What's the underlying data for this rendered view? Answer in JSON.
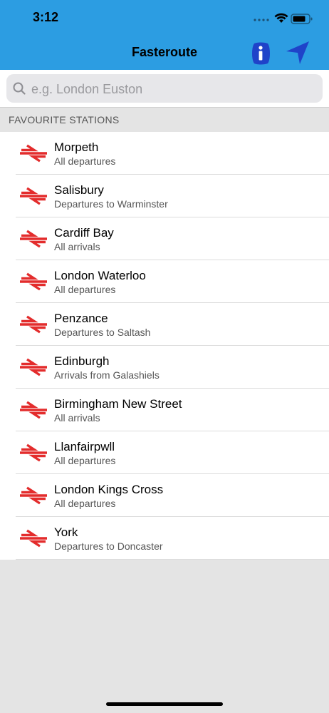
{
  "status_bar": {
    "time": "3:12"
  },
  "nav": {
    "title": "Fasteroute"
  },
  "search": {
    "placeholder": "e.g. London Euston",
    "value": ""
  },
  "section": {
    "title": "FAVOURITE STATIONS"
  },
  "colors": {
    "header": "#2c9de2",
    "rail_logo": "#e32c2c",
    "info_button": "#1f43c9",
    "locate_button": "#1f43c9"
  },
  "stations": [
    {
      "name": "Morpeth",
      "detail": "All departures"
    },
    {
      "name": "Salisbury",
      "detail": "Departures to Warminster"
    },
    {
      "name": "Cardiff Bay",
      "detail": "All arrivals"
    },
    {
      "name": "London Waterloo",
      "detail": "All departures"
    },
    {
      "name": "Penzance",
      "detail": "Departures to Saltash"
    },
    {
      "name": "Edinburgh",
      "detail": "Arrivals from Galashiels"
    },
    {
      "name": "Birmingham New Street",
      "detail": "All arrivals"
    },
    {
      "name": "Llanfairpwll",
      "detail": "All departures"
    },
    {
      "name": "London Kings Cross",
      "detail": "All departures"
    },
    {
      "name": "York",
      "detail": "Departures to Doncaster"
    }
  ]
}
